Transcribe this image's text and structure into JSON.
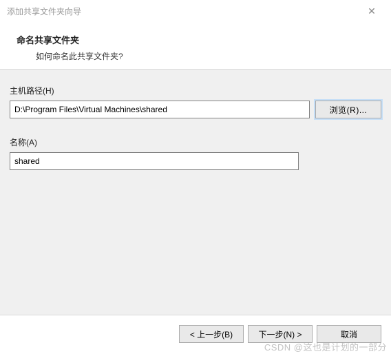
{
  "titlebar": {
    "title": "添加共享文件夹向导",
    "close_icon": "✕"
  },
  "header": {
    "title": "命名共享文件夹",
    "subtitle": "如何命名此共享文件夹?"
  },
  "form": {
    "host_path": {
      "label": "主机路径(H)",
      "value": "D:\\Program Files\\Virtual Machines\\shared",
      "browse_label": "浏览(R)..."
    },
    "name": {
      "label": "名称(A)",
      "value": "shared"
    }
  },
  "footer": {
    "back_label": "< 上一步(B)",
    "next_label": "下一步(N) >",
    "cancel_label": "取消"
  },
  "watermark": "CSDN @这也是计划的一部分"
}
